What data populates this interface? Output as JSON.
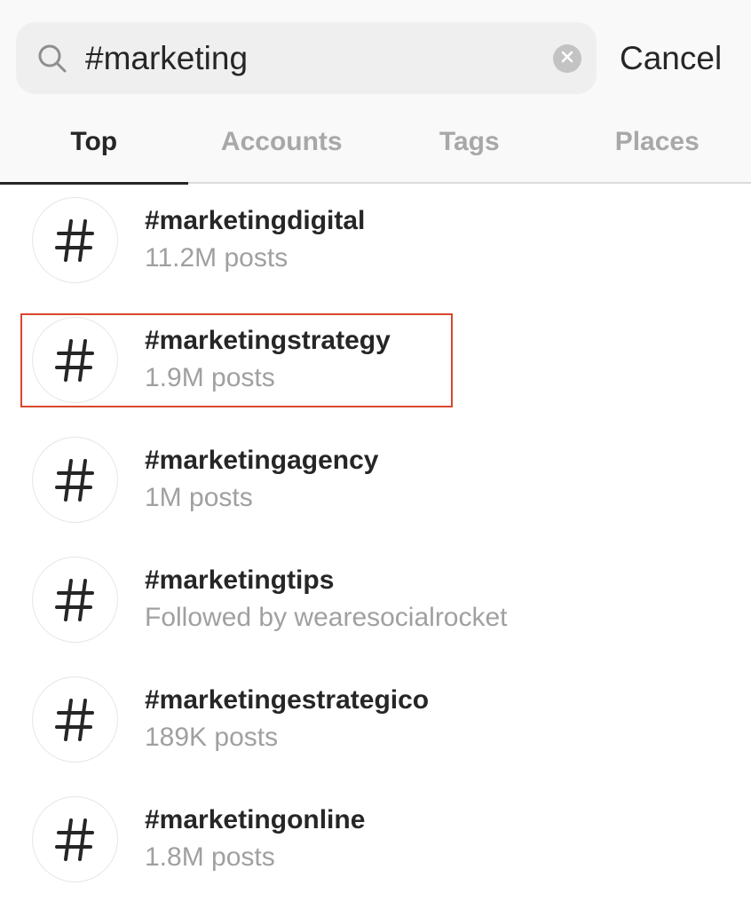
{
  "search": {
    "query": "#marketing",
    "icon": "search-icon",
    "clear_icon": "clear-icon",
    "cancel_label": "Cancel"
  },
  "tabs": [
    {
      "label": "Top",
      "active": true
    },
    {
      "label": "Accounts",
      "active": false
    },
    {
      "label": "Tags",
      "active": false
    },
    {
      "label": "Places",
      "active": false
    }
  ],
  "results": [
    {
      "name": "#marketingdigital",
      "meta": "11.2M posts",
      "icon": "hashtag-icon"
    },
    {
      "name": "#marketingstrategy",
      "meta": "1.9M posts",
      "icon": "hashtag-icon",
      "highlighted": true
    },
    {
      "name": "#marketingagency",
      "meta": "1M posts",
      "icon": "hashtag-icon"
    },
    {
      "name": "#marketingtips",
      "meta": "Followed by wearesocialrocket",
      "icon": "hashtag-icon"
    },
    {
      "name": "#marketingestrategico",
      "meta": "189K posts",
      "icon": "hashtag-icon"
    },
    {
      "name": "#marketingonline",
      "meta": "1.8M posts",
      "icon": "hashtag-icon"
    }
  ],
  "colors": {
    "highlight": "#d9472e",
    "primary_text": "#262626",
    "secondary_text": "#a0a0a0",
    "inactive_tab": "#a8a8a8"
  }
}
